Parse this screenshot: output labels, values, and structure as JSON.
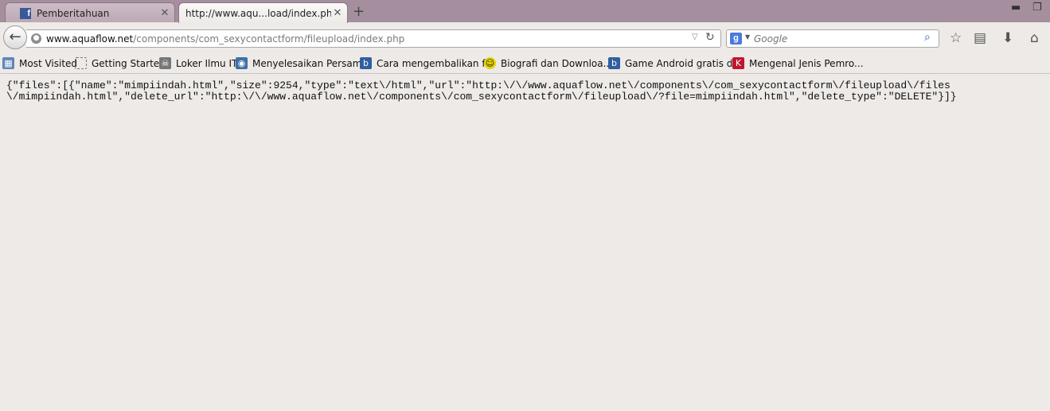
{
  "tabs": [
    {
      "label": "Pemberitahuan",
      "icon": "facebook-icon",
      "active": false
    },
    {
      "label": "http://www.aqu...load/index.php",
      "icon": "",
      "active": true
    }
  ],
  "nav": {
    "url_domain": "www.aquaflow.net",
    "url_path": "/components/com_sexycontactform/fileupload/index.php",
    "search_placeholder": "Google"
  },
  "bookmarks": [
    {
      "label": "Most Visited",
      "icon": "most-visited-icon"
    },
    {
      "label": "Getting Started",
      "icon": "page-icon"
    },
    {
      "label": "Loker Ilmu IT",
      "icon": "pirate-icon"
    },
    {
      "label": "Menyelesaikan Persam...",
      "icon": "site-icon"
    },
    {
      "label": "Cara mengembalikan f...",
      "icon": "blogger-icon"
    },
    {
      "label": "Biografi dan Downloa...",
      "icon": "smiley-icon"
    },
    {
      "label": "Game Android gratis d...",
      "icon": "blogger-icon"
    },
    {
      "label": "Mengenal Jenis Pemro...",
      "icon": "red-k-icon"
    }
  ],
  "content": {
    "line1": "{\"files\":[{\"name\":\"mimpiindah.html\",\"size\":9254,\"type\":\"text\\/html\",\"url\":\"http:\\/\\/www.aquaflow.net\\/components\\/com_sexycontactform\\/fileupload\\/files",
    "line2": "\\/mimpiindah.html\",\"delete_url\":\"http:\\/\\/www.aquaflow.net\\/components\\/com_sexycontactform\\/fileupload\\/?file=mimpiindah.html\",\"delete_type\":\"DELETE\"}]}"
  },
  "colors": {
    "tabstrip": "#a58f9e",
    "chrome": "#edeae7"
  }
}
